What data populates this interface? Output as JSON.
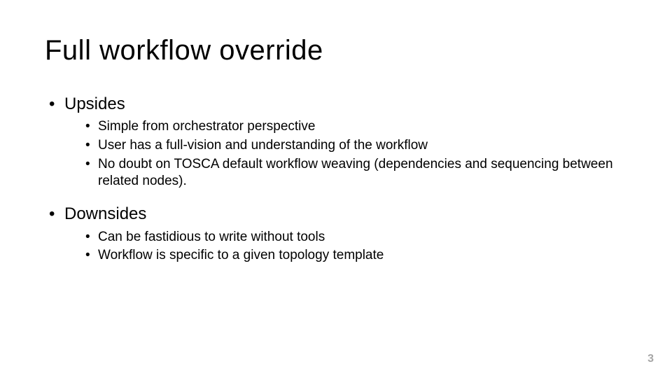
{
  "title": "Full workflow override",
  "sections": [
    {
      "heading": "Upsides",
      "items": [
        "Simple from orchestrator perspective",
        "User has a full-vision and understanding of the workflow",
        "No doubt on TOSCA default workflow weaving (dependencies and sequencing between related nodes)."
      ]
    },
    {
      "heading": "Downsides",
      "items": [
        "Can be fastidious to write without tools",
        "Workflow is specific to a given topology template"
      ]
    }
  ],
  "page_number": "3"
}
